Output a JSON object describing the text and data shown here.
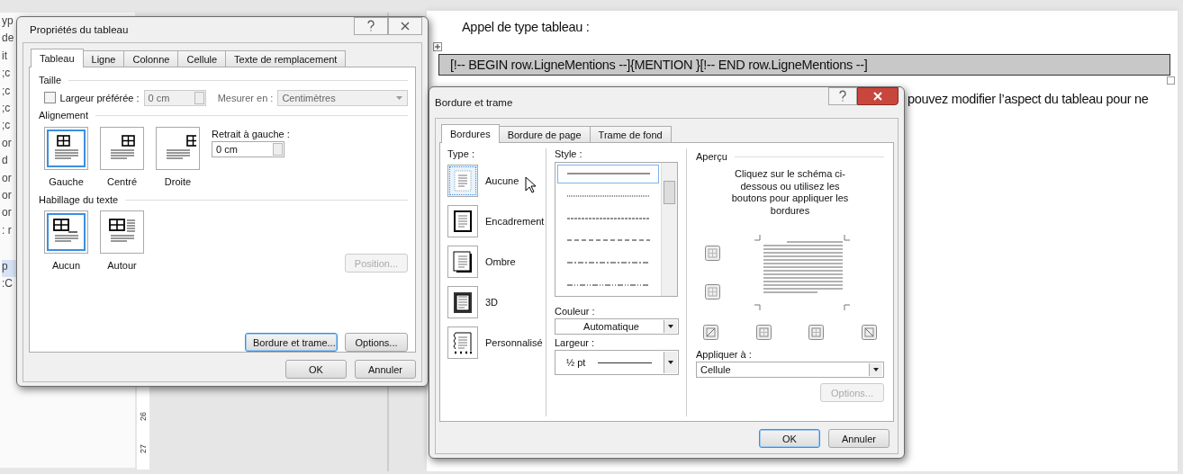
{
  "left_pane": {
    "fragments": [
      "yp",
      "de",
      "it",
      ";c",
      ";c",
      ";c",
      ";c",
      "or",
      "d",
      "or",
      "or",
      "or",
      ": r"
    ],
    "highlighted": "p",
    "last": ":C"
  },
  "ruler": {
    "labels": [
      "26",
      "27"
    ]
  },
  "document": {
    "heading": "Appel de type tableau :",
    "table_row": "[!-- BEGIN row.LigneMentions --]{MENTION }[!-- END row.LigneMentions --]",
    "paragraph": "pouvez modifier l’aspect du tableau pour ne"
  },
  "table_properties": {
    "title": "Propriétés du tableau",
    "tabs": [
      {
        "label": "Tableau",
        "selected": true
      },
      {
        "label": "Ligne",
        "selected": false
      },
      {
        "label": "Colonne",
        "selected": false
      },
      {
        "label": "Cellule",
        "selected": false
      },
      {
        "label": "Texte de remplacement",
        "selected": false
      }
    ],
    "size": {
      "heading": "Taille",
      "preferred_width": {
        "label": "Largeur préférée :",
        "checked": false,
        "value": "0 cm"
      },
      "measure": {
        "label": "Mesurer en :",
        "value": "Centimètres"
      }
    },
    "alignment": {
      "heading": "Alignement",
      "options": [
        {
          "label": "Gauche",
          "kind": "left",
          "selected": true
        },
        {
          "label": "Centré",
          "kind": "center",
          "selected": false
        },
        {
          "label": "Droite",
          "kind": "right",
          "selected": false
        }
      ],
      "indent": {
        "label": "Retrait à gauche :",
        "value": "0 cm"
      }
    },
    "wrapping": {
      "heading": "Habillage du texte",
      "options": [
        {
          "label": "Aucun",
          "kind": "none",
          "selected": true
        },
        {
          "label": "Autour",
          "kind": "around",
          "selected": false
        }
      ],
      "position_button": {
        "label": "Position...",
        "disabled": true
      }
    },
    "buttons": [
      {
        "label": "Bordure et trame...",
        "focused": true
      },
      {
        "label": "Options...",
        "focused": false
      }
    ],
    "footer_buttons": [
      {
        "label": "OK",
        "focused": false
      },
      {
        "label": "Annuler",
        "focused": false
      }
    ]
  },
  "borders_shading": {
    "title": "Bordure et trame",
    "tabs": [
      {
        "label": "Bordures",
        "selected": true
      },
      {
        "label": "Bordure de page",
        "selected": false
      },
      {
        "label": "Trame de fond",
        "selected": false
      }
    ],
    "type": {
      "label": "Type :",
      "options": [
        {
          "label": "Aucune",
          "kind": "none",
          "selected": true
        },
        {
          "label": "Encadrement",
          "kind": "box",
          "selected": false
        },
        {
          "label": "Ombre",
          "kind": "shadow",
          "selected": false
        },
        {
          "label": "3D",
          "kind": "threed",
          "selected": false
        },
        {
          "label": "Personnalisé",
          "kind": "custom",
          "selected": false
        }
      ]
    },
    "style": {
      "label": "Style :",
      "options": [
        {
          "kind": "solid",
          "selected": true
        },
        {
          "kind": "dotted",
          "selected": false
        },
        {
          "kind": "fine-dash",
          "selected": false
        },
        {
          "kind": "dash",
          "selected": false
        },
        {
          "kind": "dash-dot",
          "selected": false
        },
        {
          "kind": "dash-dot-dot",
          "selected": false
        }
      ]
    },
    "color": {
      "label": "Couleur :",
      "value": "Automatique"
    },
    "width": {
      "label": "Largeur :",
      "value": "½ pt"
    },
    "preview": {
      "heading": "Aperçu",
      "instructions": "Cliquez sur le schéma ci-dessous ou utilisez les boutons pour appliquer les bordures"
    },
    "apply_to": {
      "label": "Appliquer à :",
      "value": "Cellule"
    },
    "options_button": {
      "label": "Options...",
      "disabled": true
    },
    "footer_buttons": [
      {
        "label": "OK",
        "focused": true
      },
      {
        "label": "Annuler",
        "focused": false
      }
    ]
  }
}
